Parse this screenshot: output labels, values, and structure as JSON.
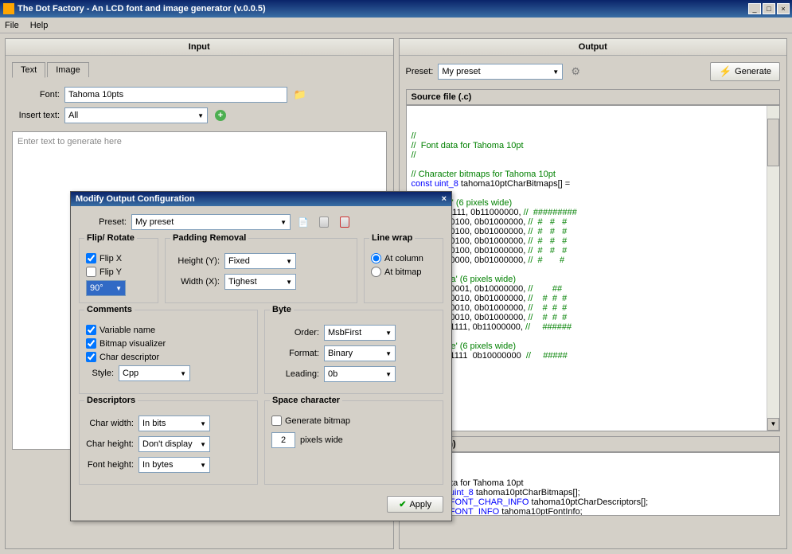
{
  "window": {
    "title": "The Dot Factory - An LCD font and image generator (v.0.0.5)"
  },
  "menu": {
    "file": "File",
    "help": "Help"
  },
  "input": {
    "header": "Input",
    "tabs": {
      "text": "Text",
      "image": "Image"
    },
    "font_label": "Font:",
    "font_value": "Tahoma 10pts",
    "insert_label": "Insert text:",
    "insert_value": "All",
    "placeholder": "Enter text to generate here"
  },
  "output": {
    "header": "Output",
    "preset_label": "Preset:",
    "preset_value": "My preset",
    "generate": "Generate",
    "source_label": "Source file (.c)",
    "header_label": "der file (.h)",
    "src_code": "//\n//  Font data for Tahoma 10pt\n//\n\n// Character bitmaps for Tahoma 10pt\nconst uint_8 tahoma10ptCharBitmaps[] =\n\n    // @0 'E' (6 pixels wide)\n    0b01111111, 0b11000000, //  #########\n    0b01000100, 0b01000000, //  #   #   #\n    0b01000100, 0b01000000, //  #   #   #\n    0b01000100, 0b01000000, //  #   #   #\n    0b01000100, 0b01000000, //  #   #   #\n    0b01000000, 0b01000000, //  #       #\n\n    // @12 'a' (6 pixels wide)\n    0b00000001, 0b10000000, //        ##\n    0b00010010, 0b01000000, //    #  #  #\n    0b00010010, 0b01000000, //    #  #  #\n    0b00010010, 0b01000000, //    #  #  #\n    0b00001111, 0b11000000, //     ######\n\n    // @24 'e' (6 pixels wide)\n    0b00001111  0b10000000  //     #####",
    "hdr_code": "    Font data for Tahoma 10pt\nern const uint_8 tahoma10ptCharBitmaps[];\nern const FONT_CHAR_INFO tahoma10ptCharDescriptors[];\nern const FONT_INFO tahoma10ptFontInfo;"
  },
  "dialog": {
    "title": "Modify Output Configuration",
    "preset_label": "Preset:",
    "preset_value": "My preset",
    "flip_rotate": {
      "legend": "Flip/ Rotate",
      "flip_x": "Flip X",
      "flip_y": "Flip Y",
      "angle": "90°"
    },
    "padding": {
      "legend": "Padding Removal",
      "height_label": "Height (Y):",
      "height_value": "Fixed",
      "width_label": "Width (X):",
      "width_value": "Tighest"
    },
    "linewrap": {
      "legend": "Line wrap",
      "at_column": "At column",
      "at_bitmap": "At bitmap"
    },
    "comments": {
      "legend": "Comments",
      "var_name": "Variable name",
      "bmp_vis": "Bitmap visualizer",
      "char_desc": "Char descriptor",
      "style_label": "Style:",
      "style_value": "Cpp"
    },
    "byte": {
      "legend": "Byte",
      "order_label": "Order:",
      "order_value": "MsbFirst",
      "format_label": "Format:",
      "format_value": "Binary",
      "leading_label": "Leading:",
      "leading_value": "0b"
    },
    "descriptors": {
      "legend": "Descriptors",
      "char_width_label": "Char width:",
      "char_width_value": "In bits",
      "char_height_label": "Char height:",
      "char_height_value": "Don't display",
      "font_height_label": "Font height:",
      "font_height_value": "In bytes"
    },
    "space": {
      "legend": "Space character",
      "gen_bitmap": "Generate bitmap",
      "pixels_value": "2",
      "pixels_suffix": "pixels wide"
    },
    "apply": "Apply"
  }
}
